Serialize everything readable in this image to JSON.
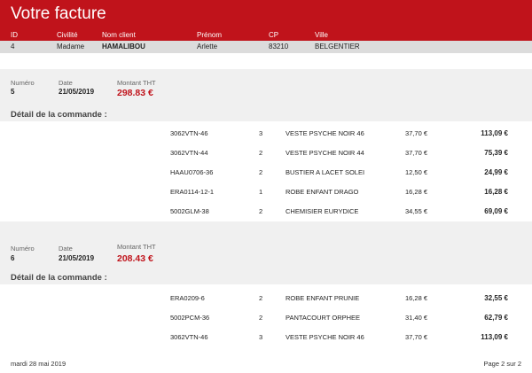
{
  "header": {
    "title": "Votre facture",
    "columns": [
      "ID",
      "Civilité",
      "Nom client",
      "Prénom",
      "CP",
      "Ville"
    ]
  },
  "client": {
    "id": "4",
    "civilite": "Madame",
    "nom": "HAMALIBOU",
    "prenom": "Arlette",
    "cp": "83210",
    "ville": "BELGENTIER"
  },
  "labels": {
    "numero": "Numéro",
    "date": "Date",
    "montant": "Montant THT",
    "detail": "Détail de la commande :"
  },
  "orders": [
    {
      "numero": "5",
      "date": "21/05/2019",
      "montant": "298.83 €",
      "lines": [
        [
          "3062VTN-46",
          "3",
          "VESTE PSYCHE NOIR 46",
          "37,70 €",
          "113,09 €"
        ],
        [
          "3062VTN-44",
          "2",
          "VESTE PSYCHE NOIR 44",
          "37,70 €",
          "75,39 €"
        ],
        [
          "HAAU0706-36",
          "2",
          "BUSTIER A LACET SOLEI",
          "12,50 €",
          "24,99 €"
        ],
        [
          "ERA0114-12-1",
          "1",
          "ROBE ENFANT DRAGO",
          "16,28 €",
          "16,28 €"
        ],
        [
          "5002GLM-38",
          "2",
          "CHEMISIER EURYDICE",
          "34,55 €",
          "69,09 €"
        ]
      ]
    },
    {
      "numero": "6",
      "date": "21/05/2019",
      "montant": "208.43 €",
      "lines": [
        [
          "ERA0209-6",
          "2",
          "ROBE ENFANT PRUNIE",
          "16,28 €",
          "32,55 €"
        ],
        [
          "5002PCM-36",
          "2",
          "PANTACOURT ORPHEE",
          "31,40 €",
          "62,79 €"
        ],
        [
          "3062VTN-46",
          "3",
          "VESTE PSYCHE NOIR 46",
          "37,70 €",
          "113,09 €"
        ]
      ]
    }
  ],
  "footer": {
    "date": "mardi 28 mai 2019",
    "page": "Page 2 sur 2"
  }
}
